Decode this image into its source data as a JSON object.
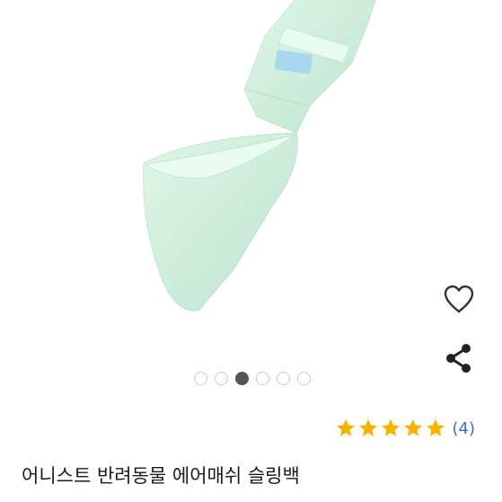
{
  "product": {
    "title": "어니스트 반려동물 에어매쉬 슬링백",
    "image_alt": "mint air mesh pet sling bag"
  },
  "actions": {
    "wishlist_icon": "heart-outline-icon",
    "share_icon": "share-icon"
  },
  "carousel": {
    "total": 6,
    "active_index": 2
  },
  "rating": {
    "stars": 5,
    "max_stars": 5,
    "review_count": "(4)",
    "star_color": "#f5b300"
  },
  "colors": {
    "mint": "#d8f3e4",
    "mint_shadow": "#b7dcc7",
    "label_blue": "#9fd3ee",
    "review_link": "#3a6fcf"
  }
}
